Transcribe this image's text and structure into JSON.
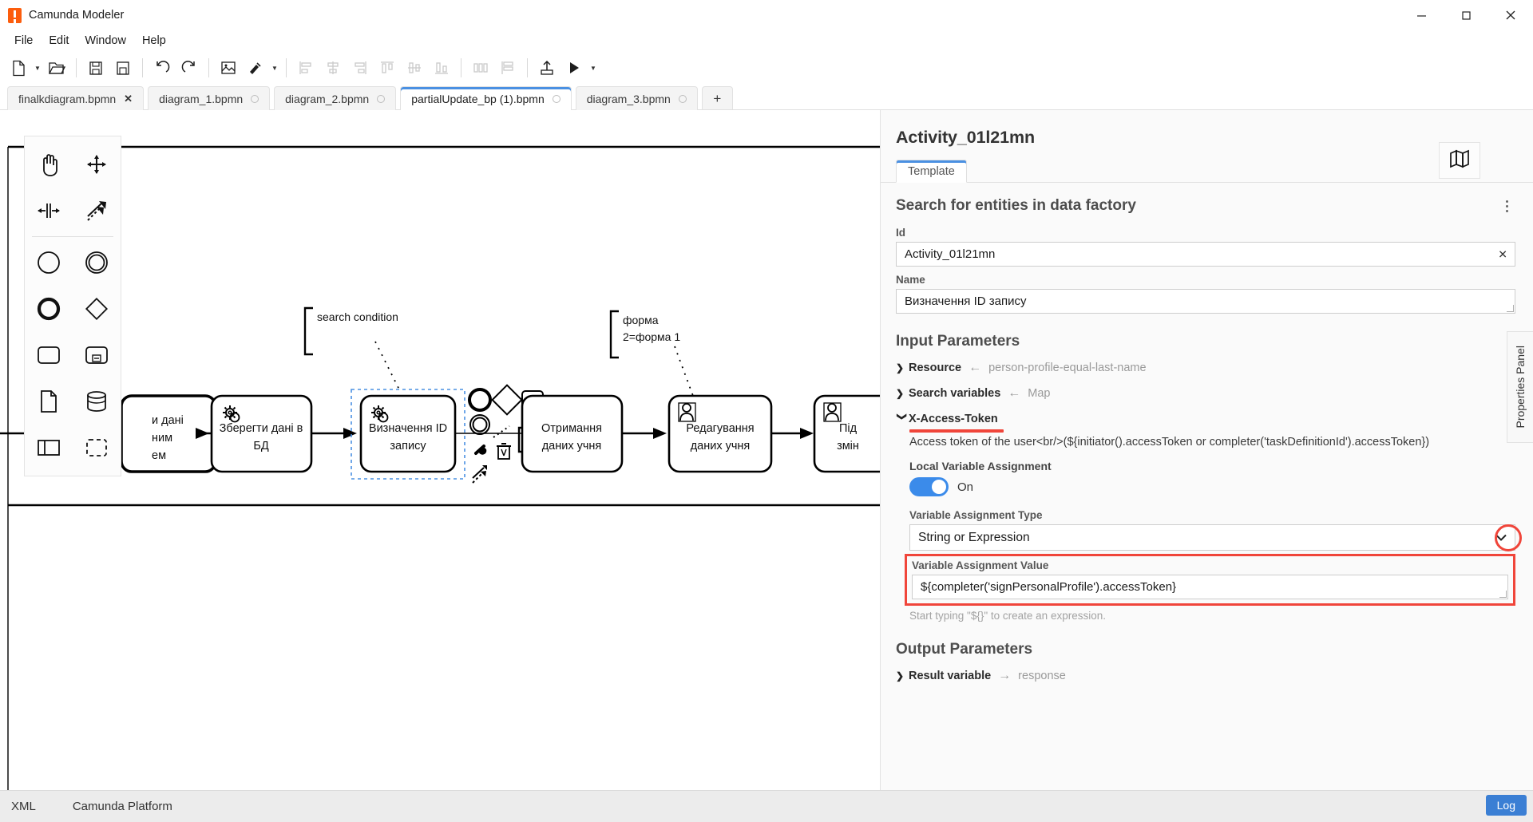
{
  "window": {
    "title": "Camunda Modeler",
    "logo_icon": "camunda-logo-icon",
    "minimize_icon": "minimize-icon",
    "maximize_icon": "maximize-icon",
    "close_icon": "close-icon"
  },
  "menubar": {
    "items": [
      {
        "label": "File"
      },
      {
        "label": "Edit"
      },
      {
        "label": "Window"
      },
      {
        "label": "Help"
      }
    ]
  },
  "toolbar": {
    "buttons": [
      {
        "name": "new-file-icon",
        "enabled": true
      },
      {
        "name": "new-file-dropdown-caret",
        "enabled": true
      },
      {
        "name": "open-file-icon",
        "enabled": true
      },
      {
        "name": "save-icon",
        "enabled": true
      },
      {
        "name": "save-as-icon",
        "enabled": true
      },
      {
        "name": "undo-icon",
        "enabled": true
      },
      {
        "name": "redo-icon",
        "enabled": true
      },
      {
        "name": "export-image-icon",
        "enabled": true
      },
      {
        "name": "align-tool-icon",
        "enabled": true
      },
      {
        "name": "align-tool-caret",
        "enabled": true
      },
      {
        "name": "align-left-icon",
        "enabled": false
      },
      {
        "name": "align-center-horizontal-icon",
        "enabled": false
      },
      {
        "name": "align-right-icon",
        "enabled": false
      },
      {
        "name": "align-top-icon",
        "enabled": false
      },
      {
        "name": "align-middle-icon",
        "enabled": false
      },
      {
        "name": "align-bottom-icon",
        "enabled": false
      },
      {
        "name": "distribute-horizontal-icon",
        "enabled": false
      },
      {
        "name": "distribute-vertical-icon",
        "enabled": false
      },
      {
        "name": "deploy-icon",
        "enabled": true
      },
      {
        "name": "run-icon",
        "enabled": true
      },
      {
        "name": "run-caret",
        "enabled": true
      }
    ]
  },
  "tabs": {
    "items": [
      {
        "label": "finalkdiagram.bpmn",
        "active": false,
        "indicator": "close"
      },
      {
        "label": "diagram_1.bpmn",
        "active": false,
        "indicator": "dot"
      },
      {
        "label": "diagram_2.bpmn",
        "active": false,
        "indicator": "dot"
      },
      {
        "label": "partialUpdate_bp (1).bpmn",
        "active": true,
        "indicator": "dot"
      },
      {
        "label": "diagram_3.bpmn",
        "active": false,
        "indicator": "dot"
      }
    ],
    "add_label": "+"
  },
  "canvas": {
    "palette": {
      "tools": [
        {
          "name": "hand-tool-icon"
        },
        {
          "name": "lasso-tool-icon"
        },
        {
          "name": "space-tool-icon"
        },
        {
          "name": "connect-tool-icon"
        }
      ],
      "elements": [
        {
          "name": "start-event-icon"
        },
        {
          "name": "intermediate-event-icon"
        },
        {
          "name": "end-event-icon"
        },
        {
          "name": "gateway-icon"
        },
        {
          "name": "task-icon"
        },
        {
          "name": "subprocess-icon"
        },
        {
          "name": "data-object-icon"
        },
        {
          "name": "data-store-icon"
        },
        {
          "name": "participant-icon"
        },
        {
          "name": "group-icon"
        }
      ]
    },
    "minimap_icon": "map-icon",
    "properties_panel_tab_label": "Properties Panel",
    "annotations": [
      {
        "text": "search condition"
      },
      {
        "text": "форма"
      },
      {
        "text": "2=форма 1"
      }
    ],
    "tasks": [
      {
        "id": "task-0",
        "lines": [
          "и дані",
          "ним",
          "ем"
        ],
        "type": "user",
        "selected": false
      },
      {
        "id": "task-1",
        "lines": [
          "Зберегти дані в",
          "БД"
        ],
        "type": "service",
        "selected": false
      },
      {
        "id": "task-2",
        "lines": [
          "Визначення ID",
          "запису"
        ],
        "type": "service",
        "selected": true
      },
      {
        "id": "task-3",
        "lines": [
          "Отримання",
          "даних учня"
        ],
        "type": "plain",
        "selected": false
      },
      {
        "id": "task-4",
        "lines": [
          "Редагування",
          "даних учня"
        ],
        "type": "user",
        "selected": false
      },
      {
        "id": "task-5",
        "lines": [
          "Під",
          "змін"
        ],
        "type": "user",
        "selected": false
      }
    ],
    "context_pad": [
      {
        "name": "append-end-event-icon"
      },
      {
        "name": "append-gateway-icon"
      },
      {
        "name": "append-task-icon"
      },
      {
        "name": "append-intermediate-event-icon"
      },
      {
        "name": "append-text-annotation-icon"
      },
      {
        "name": "change-type-wrench-icon"
      },
      {
        "name": "delete-trash-icon"
      },
      {
        "name": "connect-arrow-icon"
      }
    ]
  },
  "properties": {
    "title": "Activity_01l21mn",
    "tab_label": "Template",
    "group_title": "Search for entities in data factory",
    "kebab_icon": "more-options-icon",
    "id_label": "Id",
    "id_value": "Activity_01l21mn",
    "id_clear_icon": "clear-icon",
    "name_label": "Name",
    "name_value": "Визначення ID запису",
    "input_parameters_title": "Input Parameters",
    "input_parameters": [
      {
        "name": "Resource",
        "arrow": "←",
        "value": "person-profile-equal-last-name",
        "expanded": false
      },
      {
        "name": "Search variables",
        "arrow": "←",
        "value": "Map",
        "expanded": false
      },
      {
        "name": "X-Access-Token",
        "arrow": "",
        "value": "",
        "expanded": true
      }
    ],
    "x_access_token": {
      "description": "Access token of the user<br/>(${initiator().accessToken or completer('taskDefinitionId').accessToken})",
      "local_variable_assignment_label": "Local Variable Assignment",
      "toggle_state": "On",
      "variable_assignment_type_label": "Variable Assignment Type",
      "variable_assignment_type_value": "String or Expression",
      "variable_assignment_value_label": "Variable Assignment Value",
      "variable_assignment_value": "${completer('signPersonalProfile').accessToken}",
      "hint": "Start typing \"${}\" to create an expression.",
      "dropdown_icon": "chevron-down-icon"
    },
    "output_parameters_title": "Output Parameters",
    "output_parameters": [
      {
        "name": "Result variable",
        "arrow": "→",
        "value": "response"
      }
    ]
  },
  "statusbar": {
    "items": [
      {
        "label": "XML"
      },
      {
        "label": "Camunda Platform"
      }
    ],
    "log_label": "Log"
  },
  "colors": {
    "accent_blue": "#4a90e2",
    "highlight_red": "#f0453a",
    "toggle_on": "#3b8bea",
    "log_button": "#3b7fd4",
    "brand_orange": "#fc5d0d"
  }
}
